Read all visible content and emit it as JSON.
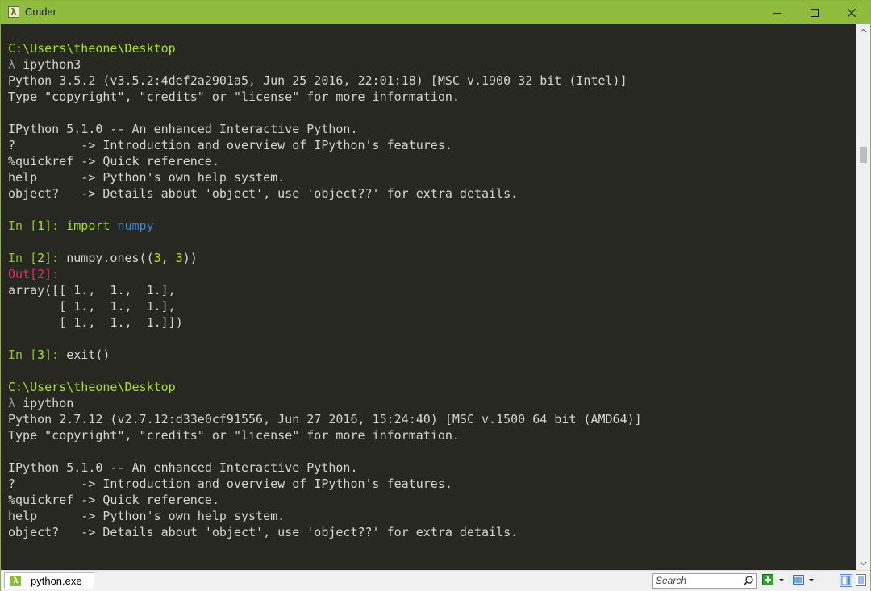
{
  "window": {
    "title": "Cmder",
    "app_icon_glyph": "λ",
    "accent": "#8fbc3c"
  },
  "terminal": {
    "lines": [
      {
        "segs": [
          {
            "t": "",
            "c": ""
          }
        ]
      },
      {
        "segs": [
          {
            "t": "C:\\Users\\theone\\Desktop",
            "c": "c-path"
          }
        ]
      },
      {
        "segs": [
          {
            "t": "λ ",
            "c": "c-lambda"
          },
          {
            "t": "ipython3",
            "c": ""
          }
        ]
      },
      {
        "segs": [
          {
            "t": "Python 3.5.2 (v3.5.2:4def2a2901a5, Jun 25 2016, 22:01:18) [MSC v.1900 32 bit (Intel)]",
            "c": ""
          }
        ]
      },
      {
        "segs": [
          {
            "t": "Type \"copyright\", \"credits\" or \"license\" for more information.",
            "c": ""
          }
        ]
      },
      {
        "segs": [
          {
            "t": "",
            "c": ""
          }
        ]
      },
      {
        "segs": [
          {
            "t": "IPython 5.1.0 -- An enhanced Interactive Python.",
            "c": ""
          }
        ]
      },
      {
        "segs": [
          {
            "t": "?         -> Introduction and overview of IPython's features.",
            "c": ""
          }
        ]
      },
      {
        "segs": [
          {
            "t": "%quickref -> Quick reference.",
            "c": ""
          }
        ]
      },
      {
        "segs": [
          {
            "t": "help      -> Python's own help system.",
            "c": ""
          }
        ]
      },
      {
        "segs": [
          {
            "t": "object?   -> Details about 'object', use 'object??' for extra details.",
            "c": ""
          }
        ]
      },
      {
        "segs": [
          {
            "t": "",
            "c": ""
          }
        ]
      },
      {
        "segs": [
          {
            "t": "In [",
            "c": "c-green"
          },
          {
            "t": "1",
            "c": "c-num"
          },
          {
            "t": "]: ",
            "c": "c-green"
          },
          {
            "t": "import",
            "c": "c-kw"
          },
          {
            "t": " ",
            "c": ""
          },
          {
            "t": "numpy",
            "c": "c-mod"
          }
        ]
      },
      {
        "segs": [
          {
            "t": "",
            "c": ""
          }
        ]
      },
      {
        "segs": [
          {
            "t": "In [",
            "c": "c-green"
          },
          {
            "t": "2",
            "c": "c-num"
          },
          {
            "t": "]: ",
            "c": "c-green"
          },
          {
            "t": "numpy.ones((",
            "c": ""
          },
          {
            "t": "3",
            "c": "c-num"
          },
          {
            "t": ", ",
            "c": ""
          },
          {
            "t": "3",
            "c": "c-num"
          },
          {
            "t": "))",
            "c": ""
          }
        ]
      },
      {
        "segs": [
          {
            "t": "Out[",
            "c": "c-out"
          },
          {
            "t": "2",
            "c": "c-out"
          },
          {
            "t": "]:",
            "c": "c-out"
          }
        ]
      },
      {
        "segs": [
          {
            "t": "array([[ 1.,  1.,  1.],",
            "c": ""
          }
        ]
      },
      {
        "segs": [
          {
            "t": "       [ 1.,  1.,  1.],",
            "c": ""
          }
        ]
      },
      {
        "segs": [
          {
            "t": "       [ 1.,  1.,  1.]])",
            "c": ""
          }
        ]
      },
      {
        "segs": [
          {
            "t": "",
            "c": ""
          }
        ]
      },
      {
        "segs": [
          {
            "t": "In [",
            "c": "c-green"
          },
          {
            "t": "3",
            "c": "c-num"
          },
          {
            "t": "]: ",
            "c": "c-green"
          },
          {
            "t": "exit()",
            "c": ""
          }
        ]
      },
      {
        "segs": [
          {
            "t": "",
            "c": ""
          }
        ]
      },
      {
        "segs": [
          {
            "t": "C:\\Users\\theone\\Desktop",
            "c": "c-path"
          }
        ]
      },
      {
        "segs": [
          {
            "t": "λ ",
            "c": "c-lambda"
          },
          {
            "t": "ipython",
            "c": ""
          }
        ]
      },
      {
        "segs": [
          {
            "t": "Python 2.7.12 (v2.7.12:d33e0cf91556, Jun 27 2016, 15:24:40) [MSC v.1500 64 bit (AMD64)]",
            "c": ""
          }
        ]
      },
      {
        "segs": [
          {
            "t": "Type \"copyright\", \"credits\" or \"license\" for more information.",
            "c": ""
          }
        ]
      },
      {
        "segs": [
          {
            "t": "",
            "c": ""
          }
        ]
      },
      {
        "segs": [
          {
            "t": "IPython 5.1.0 -- An enhanced Interactive Python.",
            "c": ""
          }
        ]
      },
      {
        "segs": [
          {
            "t": "?         -> Introduction and overview of IPython's features.",
            "c": ""
          }
        ]
      },
      {
        "segs": [
          {
            "t": "%quickref -> Quick reference.",
            "c": ""
          }
        ]
      },
      {
        "segs": [
          {
            "t": "help      -> Python's own help system.",
            "c": ""
          }
        ]
      },
      {
        "segs": [
          {
            "t": "object?   -> Details about 'object', use 'object??' for extra details.",
            "c": ""
          }
        ]
      }
    ]
  },
  "statusbar": {
    "tab_label": "python.exe",
    "tab_icon_glyph": "λ",
    "search_placeholder": "Search"
  }
}
